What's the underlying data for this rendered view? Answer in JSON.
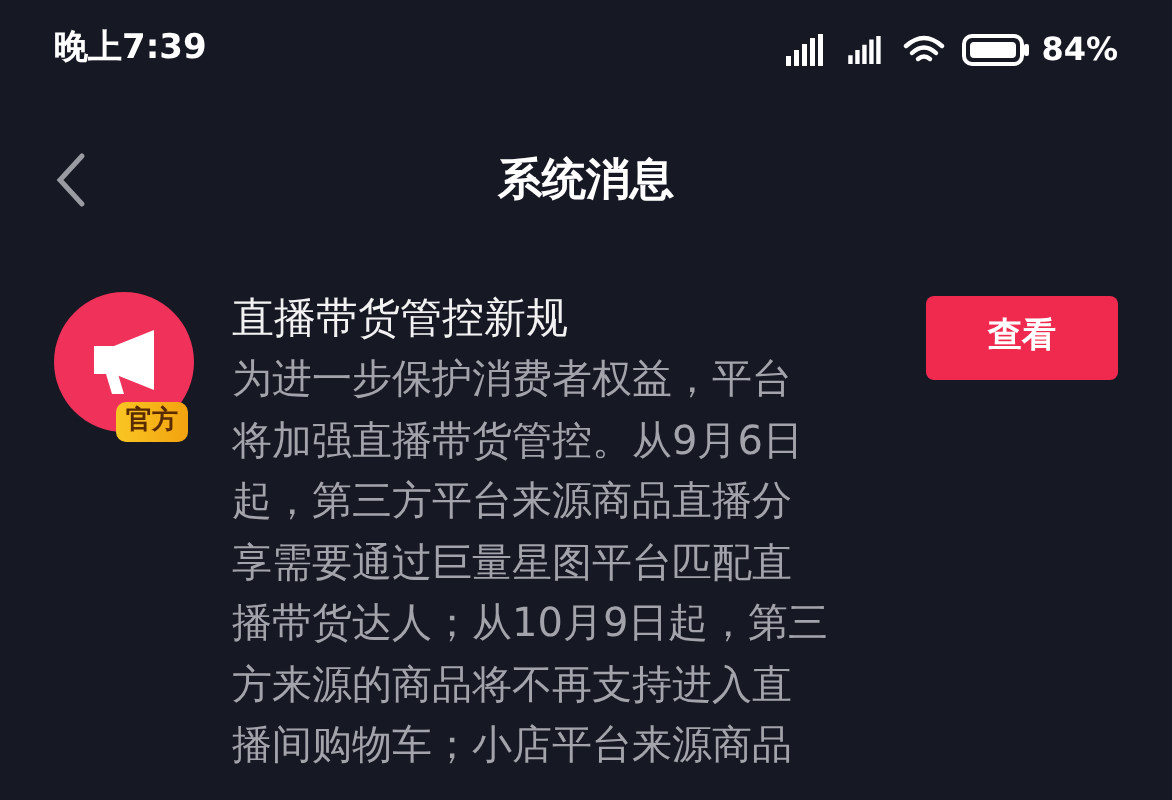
{
  "status_bar": {
    "time": "晚上7:39",
    "battery": "84%"
  },
  "nav": {
    "title": "系统消息"
  },
  "message": {
    "badge": "官方",
    "title": "直播带货管控新规",
    "body_lines": [
      "为进一步保护消费者权益，平台",
      "将加强直播带货管控。从9月6日",
      "起，第三方平台来源商品直播分",
      "享需要通过巨量星图平台匹配直",
      "播带货达人；从10月9日起，第三",
      "方来源的商品将不再支持进入直",
      "播间购物车；小店平台来源商品"
    ],
    "button": "查看"
  }
}
